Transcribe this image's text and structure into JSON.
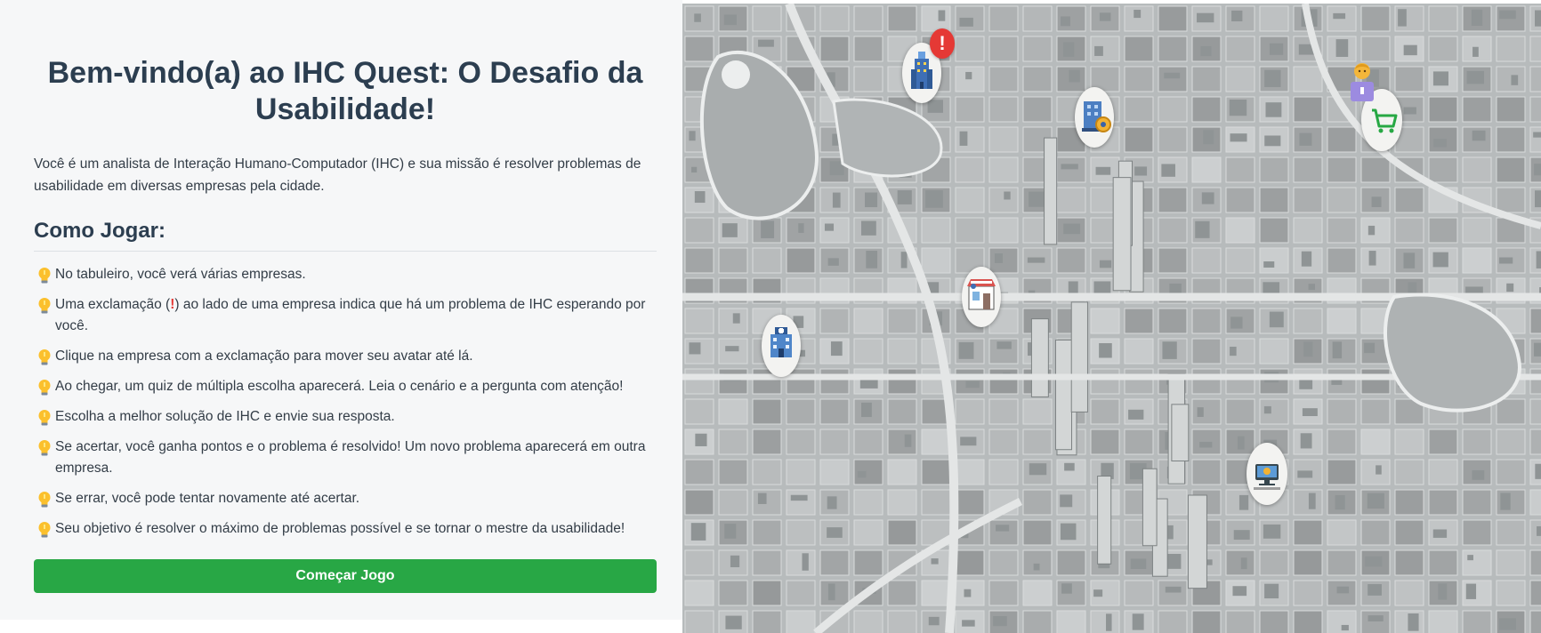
{
  "intro_panel": {
    "title": "Bem-vindo(a) ao IHC Quest: O Desafio da Usabilidade!",
    "description": "Você é um analista de Interação Humano-Computador (IHC) e sua missão é resolver problemas de usabilidade em diversas empresas pela cidade.",
    "how_to_play_heading": "Como Jogar:",
    "rules": [
      "No tabuleiro, você verá várias empresas.",
      "Clique na empresa com a exclamação para mover seu avatar até lá.",
      "Ao chegar, um quiz de múltipla escolha aparecerá. Leia o cenário e a pergunta com atenção!",
      "Escolha a melhor solução de IHC e envie sua resposta.",
      "Se acertar, você ganha pontos e o problema é resolvido! Um novo problema aparecerá em outra empresa.",
      "Se errar, você pode tentar novamente até acertar.",
      "Seu objetivo é resolver o máximo de problemas possível e se tornar o mestre da usabilidade!"
    ],
    "exclamation_rule": {
      "before": "Uma exclamação (",
      "mark": "!",
      "after": ") ao lado de uma empresa indica que há um problema de IHC esperando por você."
    },
    "start_button_label": "Começar Jogo",
    "bullet_icon": "lightbulb-icon",
    "accent_color": "#28a745",
    "title_color": "#2c3e50"
  },
  "board": {
    "alert_mark": "!",
    "alert_color": "#e53935",
    "companies": [
      {
        "name": "company-tech-tower",
        "icon": "skyscraper-icon"
      },
      {
        "name": "company-bank",
        "icon": "bank-icon"
      },
      {
        "name": "company-shop",
        "icon": "shopping-cart-icon"
      },
      {
        "name": "company-restaurant",
        "icon": "storefront-icon"
      },
      {
        "name": "company-hospital",
        "icon": "hospital-icon"
      },
      {
        "name": "company-office",
        "icon": "computer-icon"
      }
    ],
    "avatar_icon": "player-avatar-icon"
  }
}
